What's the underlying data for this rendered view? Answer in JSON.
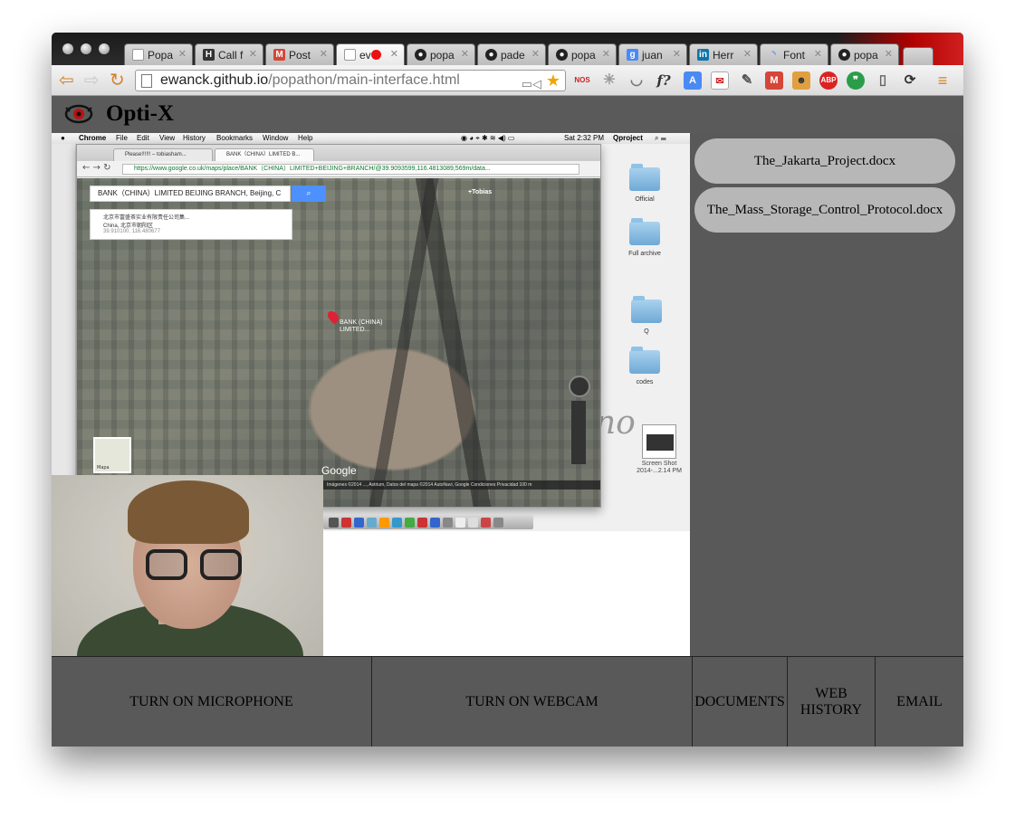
{
  "browser": {
    "tabs": [
      {
        "label": "Popa",
        "icon": "page-icon",
        "color": "#777777"
      },
      {
        "label": "Call f",
        "icon": "h-icon",
        "color": "#333333"
      },
      {
        "label": "Post",
        "icon": "gmail-icon",
        "color": "#d44638"
      },
      {
        "label": "ev",
        "icon": "page-icon",
        "color": "#777777",
        "active": true
      },
      {
        "label": "popa",
        "icon": "github-icon",
        "color": "#222222"
      },
      {
        "label": "pade",
        "icon": "github-icon",
        "color": "#222222"
      },
      {
        "label": "popa",
        "icon": "github-icon",
        "color": "#222222"
      },
      {
        "label": "juan",
        "icon": "google-icon",
        "color": "#4a8af4"
      },
      {
        "label": "Herr",
        "icon": "linkedin-icon",
        "color": "#0e76a8"
      },
      {
        "label": "Font",
        "icon": "loading-icon",
        "color": "#4a8af4"
      },
      {
        "label": "popa",
        "icon": "github-icon",
        "color": "#222222"
      }
    ],
    "url_host": "ewanck.github.io",
    "url_path": "/popathon/main-interface.html"
  },
  "app": {
    "title": "Opti-X"
  },
  "shared_screen": {
    "menubar": {
      "app": "Chrome",
      "items": [
        "File",
        "Edit",
        "View",
        "History",
        "Bookmarks",
        "Window",
        "Help"
      ],
      "clock": "Sat 2:32 PM",
      "user": "Qproject"
    },
    "inner_tabs": [
      "Please!!!!!! – tobiasham...",
      "BANK（CHINA）LIMITED B..."
    ],
    "inner_url": "https://www.google.co.uk/maps/place/BANK（CHINA）LIMITED+BEIJING+BRANCH/@39.9093599,116.4813089,569m/data...",
    "map_search": "BANK（CHINA）LIMITED BEIJING BRANCH, Beijing, C",
    "map_card_line1": "北京市富盛茶实业有限责任公司集...",
    "map_card_line2": "China, 北京市朝阳区",
    "map_card_line3": "39.910100, 116.480677",
    "pin_label": "BANK (CHINA) LIMITED...",
    "mini_map_label": "Mapa",
    "google_mark": "Google",
    "map_footer": "Imágenes ©2014 ..., Astrium, Datos del mapa ©2014 AutoNavi, Google   Condiciones   Privacidad   100 m",
    "desktop_items": [
      "Official",
      "Full archive",
      "Q",
      "codes"
    ],
    "screenshot_label_1": "Screen Shot",
    "screenshot_label_2": "2014-...2.14 PM",
    "account_label": "+Tobias"
  },
  "documents": [
    "The_Jakarta_Project.docx",
    "The_Mass_Storage_Control_Protocol.docx"
  ],
  "bottom_bar": {
    "microphone": "TURN ON MICROPHONE",
    "webcam": "TURN ON WEBCAM",
    "documents": "DOCUMENTS",
    "web_history_1": "WEB",
    "web_history_2": "HISTORY",
    "email": "EMAIL"
  }
}
